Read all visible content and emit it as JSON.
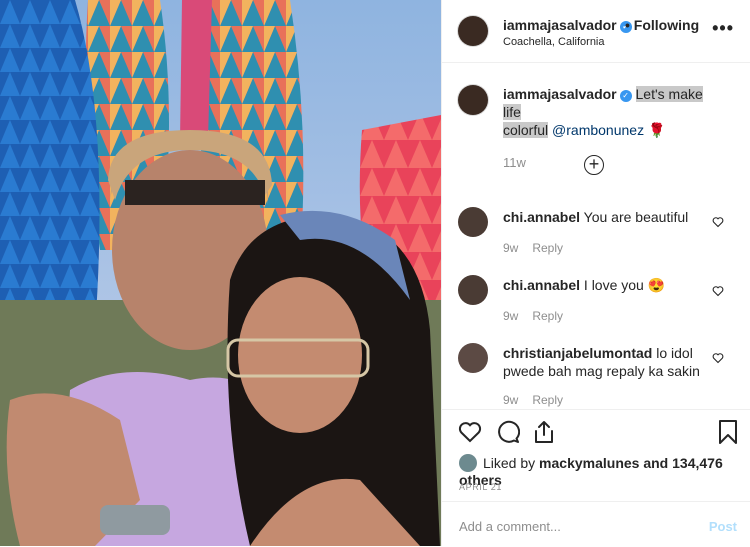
{
  "post": {
    "author": "iammajasalvador",
    "location": "Coachella, California",
    "follow_separator": "•",
    "follow_label": "Following",
    "more_label": "•••",
    "verified_glyph": "✓"
  },
  "caption": {
    "author": "iammajasalvador",
    "text_highlighted_1": "Let's make life",
    "text_highlighted_2": "colorful",
    "mention": "@rambonunez",
    "emoji": "🌹",
    "time": "11w"
  },
  "load_more_label": "+",
  "comments": [
    {
      "user": "chi.annabel",
      "text": "You are beautiful",
      "time": "9w",
      "reply": "Reply"
    },
    {
      "user": "chi.annabel",
      "text": "I love you",
      "emoji": "😍",
      "time": "9w",
      "reply": "Reply"
    },
    {
      "user": "christianjabelumontad",
      "text": "lo idol pwede bah mag repaly ka sakin",
      "time": "9w",
      "reply": "Reply"
    }
  ],
  "likes": {
    "prefix": "Liked by",
    "user": "mackymalunes",
    "suffix": "and 134,476 others"
  },
  "date": "APRIL 21",
  "add_comment": {
    "placeholder": "Add a comment...",
    "post_label": "Post"
  },
  "colors": {
    "accent_blue": "#3897f0",
    "post_disabled": "#b2dffc",
    "muted": "#8e8e8e"
  },
  "icons": [
    "verified-icon",
    "more-options-icon",
    "load-more-icon",
    "heart-icon",
    "comment-icon",
    "share-icon",
    "bookmark-icon"
  ]
}
